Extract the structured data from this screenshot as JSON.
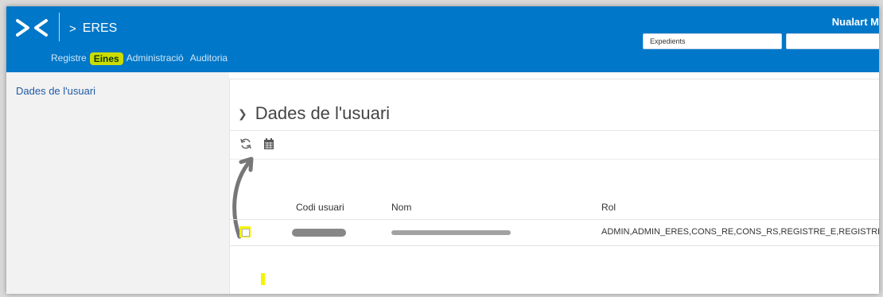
{
  "header": {
    "app": "ERES",
    "user": "Nualart M",
    "search_placeholder": "Expedients"
  },
  "menu": {
    "items": [
      "Registre",
      "Eines",
      "Administració",
      "Auditoria"
    ],
    "active": "Eines"
  },
  "sidebar": {
    "items": [
      "Dades de l'usuari"
    ]
  },
  "panel": {
    "title": "Dades de l'usuari"
  },
  "table": {
    "columns": [
      "Codi usuari",
      "Nom",
      "Rol"
    ],
    "rows": [
      {
        "codi": "",
        "nom": "",
        "rol": "ADMIN,ADMIN_ERES,CONS_RE,CONS_RS,REGISTRE_E,REGISTRE_S"
      }
    ]
  },
  "colors": {
    "brand": "#0077c8",
    "highlight": "#f4f400",
    "active_menu": "#cddc00",
    "link": "#1f5aa6"
  }
}
